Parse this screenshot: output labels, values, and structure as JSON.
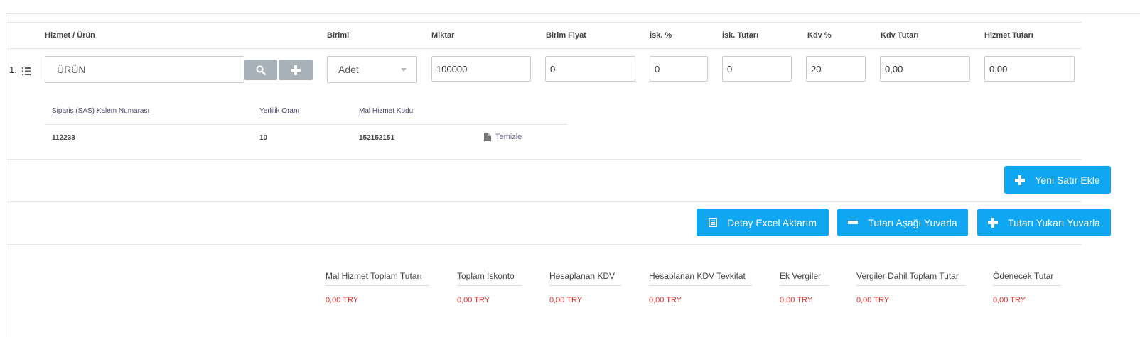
{
  "columns": {
    "service": "Hizmet / Ürün",
    "unit": "Birimi",
    "quantity": "Miktar",
    "unit_price": "Birim Fiyat",
    "discount_pct": "İsk. %",
    "discount_amount": "İsk. Tutarı",
    "vat_pct": "Kdv %",
    "vat_amount": "Kdv Tutarı",
    "service_amount": "Hizmet Tutarı"
  },
  "row": {
    "index": "1.",
    "product": "ÜRÜN",
    "unit": "Adet",
    "quantity": "100000",
    "unit_price": "0",
    "discount_pct": "0",
    "discount_amount": "0",
    "vat_pct": "20",
    "vat_amount": "0,00",
    "service_amount": "0,00"
  },
  "detail": {
    "headers": [
      "Sipariş (SAS) Kalem Numarası",
      "Yerlilik Oranı",
      "Mal Hizmet Kodu"
    ],
    "values": [
      "112233",
      "10",
      "152152151"
    ],
    "clear_label": "Temizle"
  },
  "buttons": {
    "new_row": "Yeni Satır Ekle",
    "excel_export": "Detay Excel Aktarım",
    "round_down": "Tutarı Aşağı Yuvarla",
    "round_up": "Tutarı Yukarı Yuvarla"
  },
  "totals": [
    {
      "label": "Mal Hizmet Toplam Tutarı",
      "value": "0,00 TRY"
    },
    {
      "label": "Toplam İskonto",
      "value": "0,00 TRY"
    },
    {
      "label": "Hesaplanan KDV",
      "value": "0,00 TRY"
    },
    {
      "label": "Hesaplanan KDV Tevkifat",
      "value": "0,00 TRY"
    },
    {
      "label": "Ek Vergiler",
      "value": "0,00 TRY"
    },
    {
      "label": "Vergiler Dahil Toplam Tutar",
      "value": "0,00 TRY"
    },
    {
      "label": "Ödenecek Tutar",
      "value": "0,00 TRY"
    }
  ],
  "colors": {
    "accent": "#10a7f2",
    "negative": "#e03030",
    "icon_button": "#a9b1b8"
  }
}
